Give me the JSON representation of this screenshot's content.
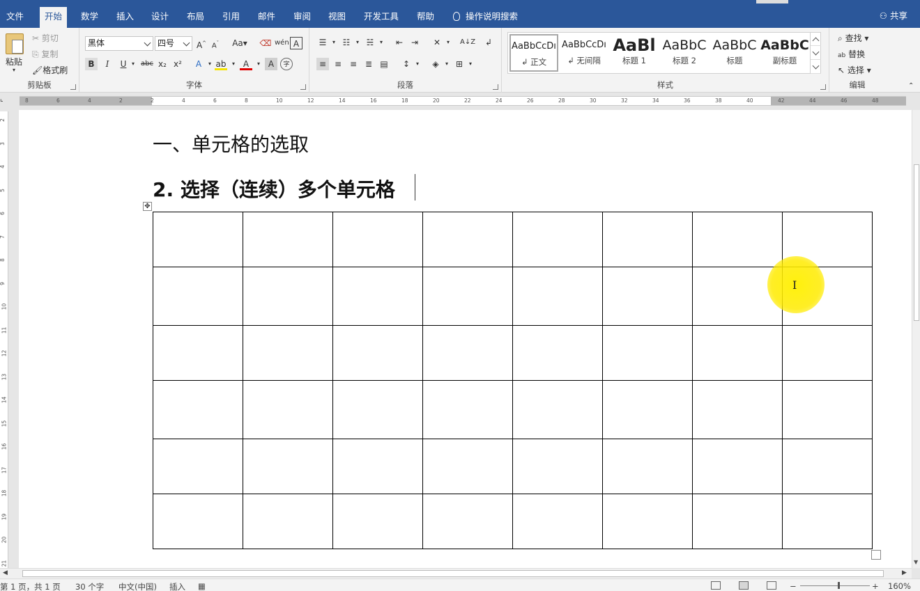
{
  "tabs": [
    "文件",
    "开始",
    "数学",
    "插入",
    "设计",
    "布局",
    "引用",
    "邮件",
    "审阅",
    "视图",
    "开发工具",
    "帮助"
  ],
  "active_tab": "开始",
  "tell_me": "操作说明搜索",
  "share": "共享",
  "clipboard": {
    "paste": "粘贴",
    "cut": "剪切",
    "copy": "复制",
    "format_painter": "格式刷",
    "label": "剪贴板"
  },
  "font": {
    "name": "黑体",
    "size": "四号",
    "label": "字体",
    "case": "Aa",
    "bold": "B",
    "italic": "I",
    "underline": "U",
    "strike": "abc",
    "sub": "x₂",
    "sup": "x²",
    "clear": "A"
  },
  "paragraph": {
    "label": "段落"
  },
  "styles": {
    "label": "样式",
    "items": [
      {
        "sample": "AaBbCcDı",
        "name": "↲ 正文"
      },
      {
        "sample": "AaBbCcDı",
        "name": "↲ 无间隔"
      },
      {
        "sample": "AaBl",
        "name": "标题 1"
      },
      {
        "sample": "AaBbC",
        "name": "标题 2"
      },
      {
        "sample": "AaBbC",
        "name": "标题"
      },
      {
        "sample": "AaBbC",
        "name": "副标题"
      }
    ]
  },
  "editing": {
    "find": "查找",
    "replace": "替换",
    "select": "选择",
    "label": "编辑"
  },
  "ruler_ticks": [
    "8",
    "6",
    "4",
    "2",
    "2",
    "4",
    "6",
    "8",
    "10",
    "12",
    "14",
    "16",
    "18",
    "20",
    "22",
    "24",
    "26",
    "28",
    "30",
    "32",
    "34",
    "36",
    "38",
    "40",
    "42",
    "44",
    "46",
    "48"
  ],
  "vruler_ticks": [
    "2",
    "3",
    "4",
    "5",
    "6",
    "7",
    "8",
    "9",
    "10",
    "11",
    "12",
    "13",
    "14",
    "15",
    "16",
    "17",
    "18",
    "19",
    "20",
    "21"
  ],
  "document": {
    "heading1": "一、单元格的选取",
    "heading2": "2.  选择（连续）多个单元格",
    "table": {
      "rows": 6,
      "cols": 8
    }
  },
  "status": {
    "page": "第 1 页，共 1 页",
    "words": "30 个字",
    "language": "中文(中国)",
    "mode": "插入",
    "zoom": "160%"
  }
}
